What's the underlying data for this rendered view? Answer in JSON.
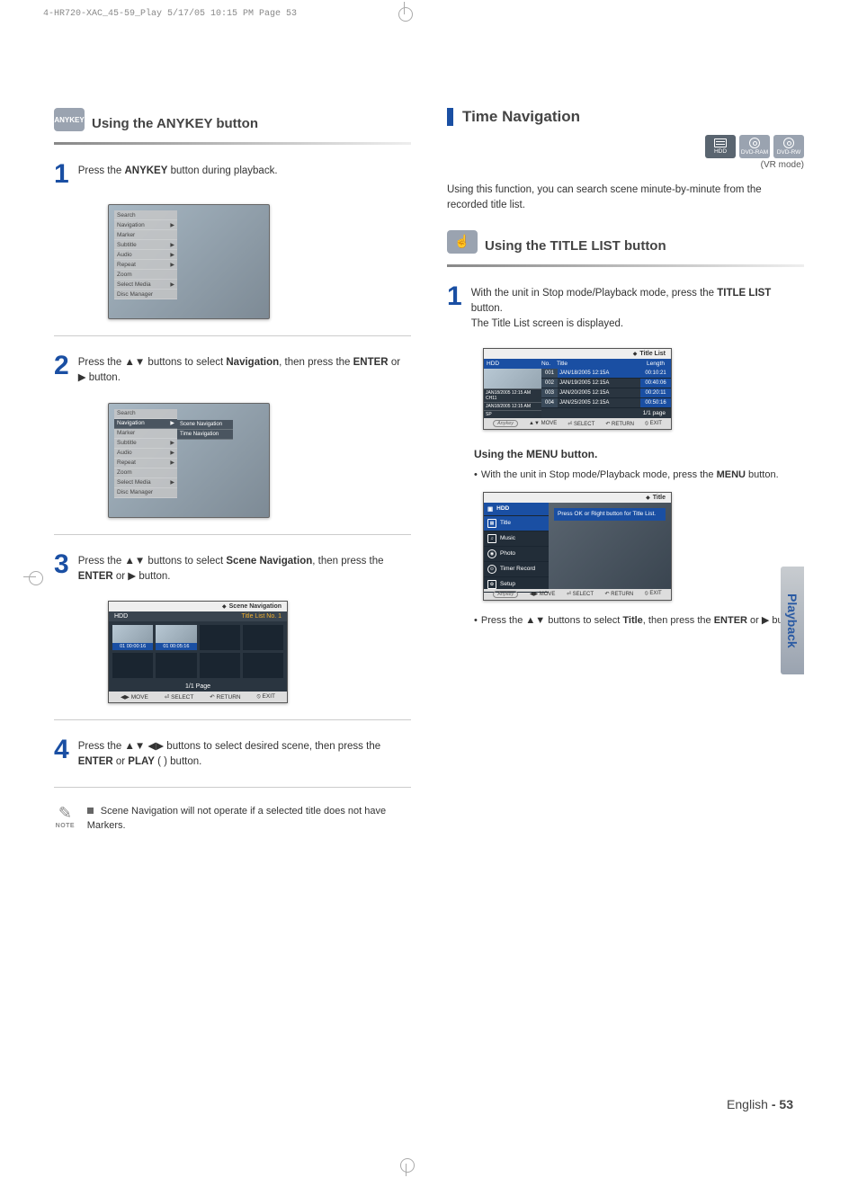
{
  "meta": {
    "crop_header": "4-HR720-XAC_45-59_Play  5/17/05  10:15 PM  Page 53"
  },
  "left": {
    "anykey_label": "ANYKEY",
    "heading": "Using the ANYKEY button",
    "step1": {
      "num": "1",
      "pre": "Press the ",
      "bold": "ANYKEY",
      "post": " button during playback."
    },
    "osd1": {
      "items": [
        "Search",
        "Navigation",
        "Marker",
        "Subtitle",
        "Audio",
        "Repeat",
        "Zoom",
        "Select Media",
        "Disc Manager"
      ]
    },
    "step2": {
      "num": "2",
      "t": "Press the ▲▼ buttons to select ",
      "b1": "Navigation",
      "t2": ", then press the ",
      "b2": "ENTER",
      "t3": " or ▶ button."
    },
    "osd2": {
      "items": [
        "Search",
        "Navigation",
        "Marker",
        "Subtitle",
        "Audio",
        "Repeat",
        "Zoom",
        "Select Media",
        "Disc Manager"
      ],
      "sub": [
        "Scene Navigation",
        "Time Navigation"
      ]
    },
    "step3": {
      "num": "3",
      "t": "Press the ▲▼ buttons to select ",
      "b1": "Scene Navigation",
      "t2": ", then press the ",
      "b2": "ENTER",
      "t3": " or ▶ button."
    },
    "scenenav": {
      "title": "Scene Navigation",
      "bar_left": "HDD",
      "bar_right": "Title List No. 1",
      "cell1": "01  00:00:16",
      "cell2": "01  00:05:16",
      "page": "1/1 Page",
      "footer": {
        "move": "MOVE",
        "select": "SELECT",
        "return": "RETURN",
        "exit": "EXIT"
      }
    },
    "step4": {
      "num": "4",
      "t": "Press the ▲▼ ◀▶ buttons to select desired scene, then press the ",
      "b1": "ENTER",
      "t2": " or ",
      "b2": "PLAY",
      "t3": " (      ) button."
    },
    "note": {
      "label": "NOTE",
      "text": "Scene Navigation will not operate if a selected title does not have Markers."
    }
  },
  "right": {
    "heading": "Time Navigation",
    "discs": {
      "hdd": "HDD",
      "ram": "DVD-RAM",
      "rw": "DVD-RW"
    },
    "vr": "(VR mode)",
    "intro": "Using this function, you can search scene minute-by-minute from the recorded title list.",
    "sub_heading": "Using the TITLE LIST button",
    "step1": {
      "num": "1",
      "t": "With the unit in Stop mode/Playback mode, press the ",
      "b": "TITLE LIST",
      "t2": " button.",
      "line2": "The Title List screen is displayed."
    },
    "titlelist": {
      "title": "Title List",
      "cols": {
        "c1": "HDD",
        "c2": "No.",
        "c3": "Title",
        "c4": "Length"
      },
      "rows": [
        {
          "no": "001",
          "title": "JAN/18/2005 12:15A",
          "len": "00:10:21"
        },
        {
          "no": "002",
          "title": "JAN/19/2005 12:15A",
          "len": "00:40:06"
        },
        {
          "no": "003",
          "title": "JAN/20/2005 12:15A",
          "len": "00:20:11"
        },
        {
          "no": "004",
          "title": "JAN/25/2005 12:15A",
          "len": "00:50:16"
        }
      ],
      "info1": "JAN18/2005 12:15 AM CH11",
      "info2": "JAN18/2005 12:15 AM",
      "info3": "SP",
      "page": "1/1  page",
      "anykey": "Anykey",
      "footer": {
        "move": "MOVE",
        "select": "SELECT",
        "return": "RETURN",
        "exit": "EXIT"
      }
    },
    "menu_h": "Using the MENU button.",
    "menu_line": {
      "t": "With the unit in Stop mode/Playback mode, press the ",
      "b": "MENU",
      "t2": " button."
    },
    "menuosd": {
      "title": "Title",
      "badge": "HDD",
      "items": [
        "Title",
        "Music",
        "Photo",
        "Timer Record",
        "Setup"
      ],
      "hint": "Press OK or Right button for Title List.",
      "anykey": "Anykey",
      "footer": {
        "move": "MOVE",
        "select": "SELECT",
        "return": "RETURN",
        "exit": "EXIT"
      }
    },
    "last": {
      "t": "Press the ▲▼ buttons to select ",
      "b1": "Title",
      "t2": ", then press the ",
      "b2": "ENTER",
      "t3": " or ▶ button."
    }
  },
  "side_tab": "Playback",
  "footer": {
    "lang": "English ",
    "dash": "- ",
    "page": "53"
  }
}
